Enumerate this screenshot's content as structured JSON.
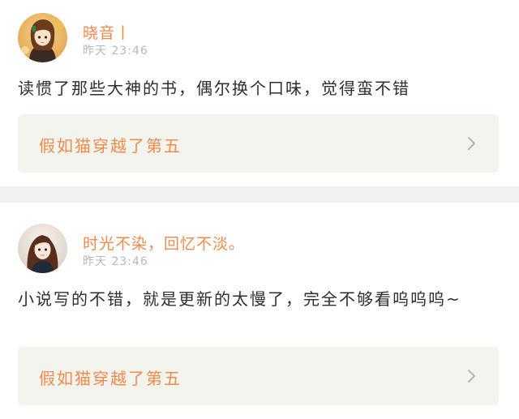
{
  "posts": [
    {
      "username": "晓音丨",
      "timestamp": "昨天 23:46",
      "comment": "读惯了那些大神的书，偶尔换个口味，觉得蛮不错",
      "book": {
        "title": "假如猫穿越了第五"
      },
      "avatar_icon": "user-avatar-anime-girl"
    },
    {
      "username": "时光不染，回忆不淡。",
      "timestamp": "昨天 23:46",
      "comment": "小说写的不错，就是更新的太慢了，完全不够看呜呜呜~",
      "book": {
        "title": "假如猫穿越了第五"
      },
      "avatar_icon": "user-avatar-photo-girl"
    }
  ],
  "colors": {
    "accent": "#f08a4b",
    "card_bg": "#f4f4ef",
    "timestamp": "#b8b8b8",
    "separator": "#f2f2f2",
    "chevron": "#b5b5b5"
  },
  "icons": {
    "chevron": "chevron-right-icon"
  }
}
